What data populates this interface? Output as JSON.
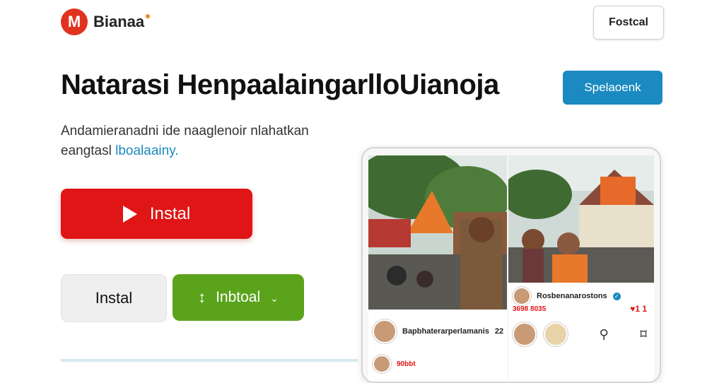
{
  "header": {
    "logo_letter": "M",
    "brand": "Bianaa",
    "top_button": "Fostcal"
  },
  "hero": {
    "headline": "Natarasi HenpaalaingarlloUianoja",
    "cta_blue": "Spelaoenk",
    "subtitle_line1": "Andamieranadni ide naaglenoir nlahatkan",
    "subtitle_line2_prefix": "eangtasl ",
    "subtitle_link": "lboalaainy."
  },
  "buttons": {
    "install_primary": "Instal",
    "install_secondary": "Instal",
    "install_green": "Inbtoal",
    "install_green_icon": "↕"
  },
  "phone": {
    "right_post": {
      "username": "Rosbenanarostons",
      "stats": "3698 8035",
      "heart_text": "♥1 1"
    },
    "left_post": {
      "username": "Bapbhaterarperlamanis",
      "count": "22",
      "note": "90bbt"
    }
  },
  "colors": {
    "primary_red": "#e01515",
    "accent_blue": "#1a8ac0",
    "green": "#5aa31b",
    "logo_red": "#e0321f"
  }
}
